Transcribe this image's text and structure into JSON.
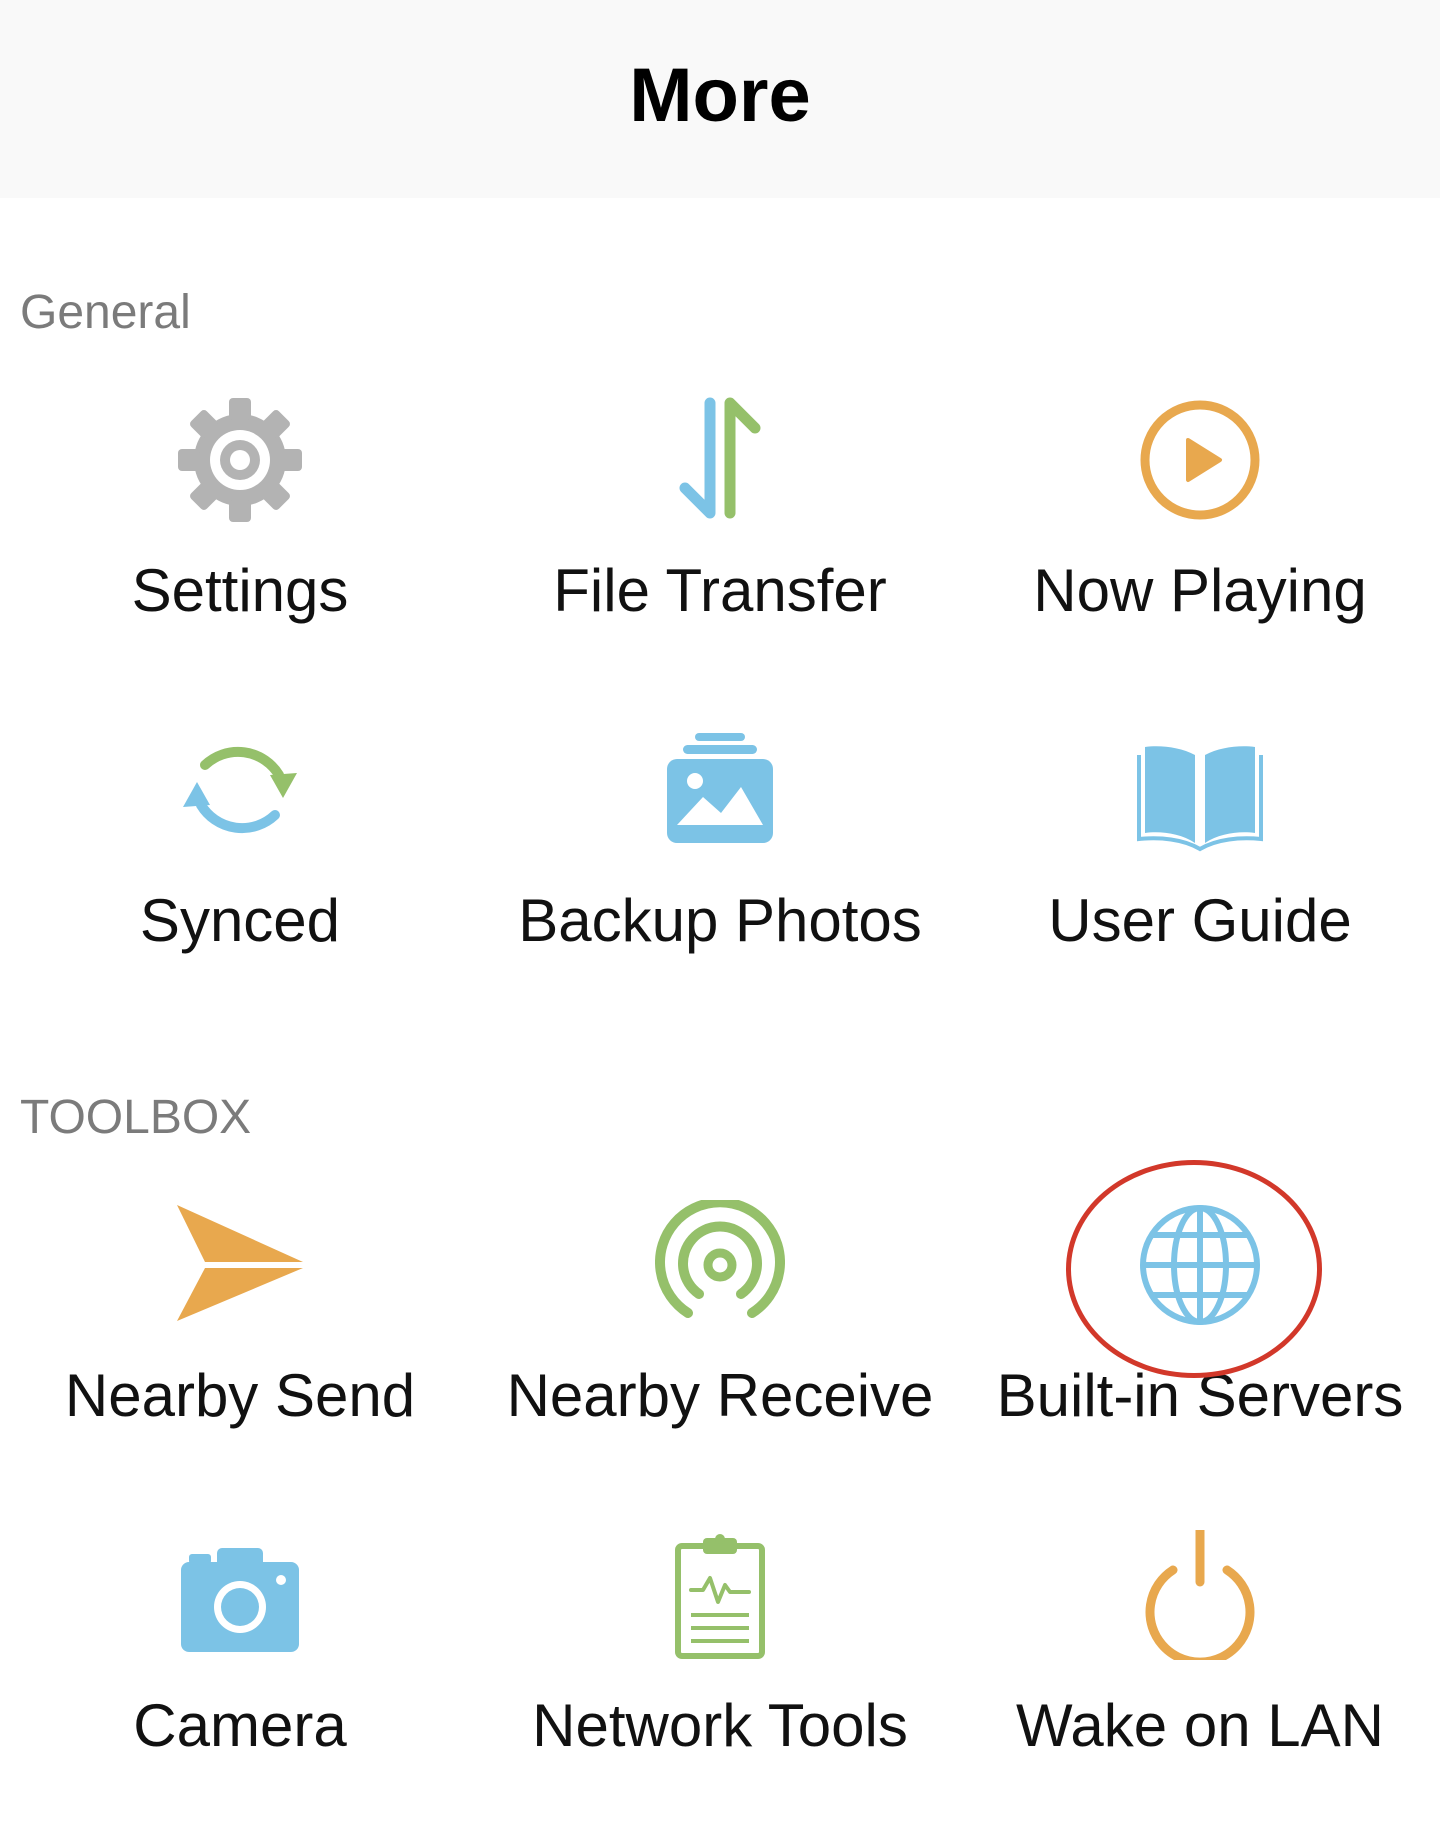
{
  "header": {
    "title": "More"
  },
  "sections": {
    "general": {
      "label": "General",
      "items": [
        {
          "label": "Settings",
          "icon": "gear-icon"
        },
        {
          "label": "File Transfer",
          "icon": "transfer-arrows-icon"
        },
        {
          "label": "Now Playing",
          "icon": "play-circle-icon"
        },
        {
          "label": "Synced",
          "icon": "sync-icon"
        },
        {
          "label": "Backup Photos",
          "icon": "photo-stack-icon"
        },
        {
          "label": "User Guide",
          "icon": "book-icon"
        }
      ]
    },
    "toolbox": {
      "label": "TOOLBOX",
      "items": [
        {
          "label": "Nearby Send",
          "icon": "paper-plane-icon"
        },
        {
          "label": "Nearby Receive",
          "icon": "signal-receive-icon"
        },
        {
          "label": "Built-in Servers",
          "icon": "globe-icon"
        },
        {
          "label": "Camera",
          "icon": "camera-icon"
        },
        {
          "label": "Network Tools",
          "icon": "clipboard-pulse-icon"
        },
        {
          "label": "Wake on LAN",
          "icon": "power-icon"
        }
      ]
    }
  },
  "colors": {
    "gray_icon": "#b3b3b3",
    "blue": "#7cc3e6",
    "green": "#95c06a",
    "orange": "#e8a84e",
    "highlight": "#d2382a"
  }
}
